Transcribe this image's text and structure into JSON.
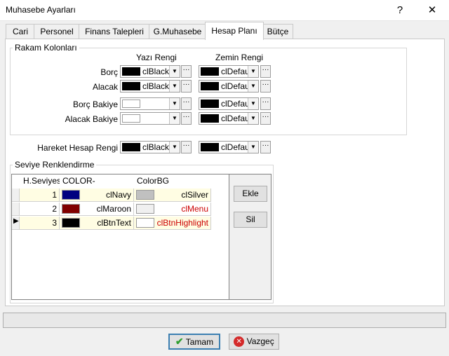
{
  "window": {
    "title": "Muhasebe Ayarları",
    "help": "?",
    "close": "✕"
  },
  "tabs": [
    "Cari",
    "Personel",
    "Finans Talepleri",
    "G.Muhasebe",
    "Hesap Planı",
    "Bütçe"
  ],
  "active_tab": "Hesap Planı",
  "rakam": {
    "group_label": "Rakam Kolonları",
    "col_fg": "Yazı Rengi",
    "col_bg": "Zemin Rengi",
    "rows": [
      {
        "label": "Borç",
        "fg": "clBlack",
        "bg": "clDefault"
      },
      {
        "label": "Alacak",
        "fg": "clBlack",
        "bg": "clDefault"
      },
      {
        "label": "Borç Bakiye",
        "fg": "",
        "bg": "clDefault"
      },
      {
        "label": "Alacak Bakiye",
        "fg": "",
        "bg": "clDefault"
      }
    ]
  },
  "hareket": {
    "label": "Hareket Hesap Rengi",
    "fg": "clBlack",
    "bg": "clDefault"
  },
  "seviye": {
    "group_label": "Seviye Renklendirme",
    "headers": [
      "H.Seviyesi",
      "COLOR-",
      "ColorBG"
    ],
    "rows": [
      {
        "level": "1",
        "color": "clNavy",
        "color_hex": "#000080",
        "bg": "clSilver",
        "bg_hex": "#c0c0c0",
        "bg_text_color": "#000000"
      },
      {
        "level": "2",
        "color": "clMaroon",
        "color_hex": "#800000",
        "bg": "clMenu",
        "bg_hex": "#f0f0f0",
        "bg_text_color": "#cc0000"
      },
      {
        "level": "3",
        "color": "clBtnText",
        "color_hex": "#000000",
        "bg": "clBtnHighlight",
        "bg_hex": "#ffffff",
        "bg_text_color": "#cc0000"
      }
    ],
    "add_label": "Ekle",
    "delete_label": "Sil"
  },
  "footer": {
    "ok_label": "Tamam",
    "cancel_label": "Vazgeç"
  },
  "colors": {
    "check_green": "#2e9e2e",
    "cancel_red": "#d42a2a",
    "focus_blue": "#3c7fb1"
  }
}
